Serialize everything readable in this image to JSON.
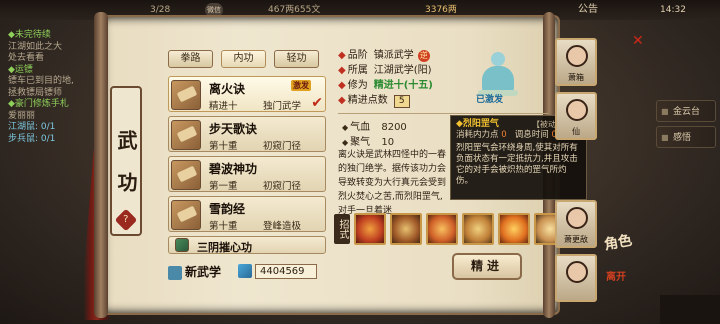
{
  "topbar": {
    "counter1": "3/28",
    "qq": "微信",
    "currency1": "467两655文",
    "currency2": "3376两",
    "notice": "公告",
    "time": "14:32"
  },
  "quest": {
    "lines": [
      {
        "text": "◆未完待续",
        "cls": "qt"
      },
      {
        "text": "江湖如此之大",
        "cls": "qx"
      },
      {
        "text": "处去看看",
        "cls": "qx"
      },
      {
        "text": "◆运镖",
        "cls": "qt"
      },
      {
        "text": "镖车已到目的地,",
        "cls": "qx"
      },
      {
        "text": "拯救镖局镖师",
        "cls": "qx"
      },
      {
        "text": "◆豪门修炼手札",
        "cls": "qt"
      },
      {
        "text": "爱丽丽",
        "cls": "qx"
      },
      {
        "text": "江湖鼠: 0/1",
        "cls": "qy"
      },
      {
        "text": "步兵鼠: 0/1",
        "cls": "qy"
      }
    ]
  },
  "title": "武功",
  "tabs": [
    "拳路",
    "内功",
    "轻功"
  ],
  "skills": [
    {
      "name": "离火诀",
      "level": "精进十",
      "path": "独门武学",
      "badge": "激发",
      "active": true
    },
    {
      "name": "步天歌诀",
      "level": "第十重",
      "path": "初窥门径",
      "badge": "",
      "active": false
    },
    {
      "name": "碧波神功",
      "level": "第一重",
      "path": "初窥门径",
      "badge": "",
      "active": false
    },
    {
      "name": "雪韵经",
      "level": "第十重",
      "path": "登峰造极",
      "badge": "",
      "active": false
    },
    {
      "name": "三阴摧心功",
      "level": "",
      "path": "",
      "badge": "",
      "active": false
    }
  ],
  "new_skill_label": "新武学",
  "skill_points": "4404569",
  "info": {
    "grade_k": "品阶",
    "grade_v": "镇派武学",
    "grade_seal": "逆",
    "belong_k": "所属",
    "belong_v": "江湖武学(阳)",
    "cult_k": "修为",
    "cult_v": "精进十(十五)",
    "pts_k": "精进点数",
    "pts_v": "5"
  },
  "monk_label": "已激发",
  "stats": {
    "hp_k": "气血",
    "hp_v": "8200",
    "qi_k": "聚气",
    "qi_v": "10"
  },
  "description": "离火诀是武林四怪中的一春的独门绝学。据传该功力会导致转变为大行真元会受到烈火焚心之苦,而烈阳罡气,对手一旦着迷",
  "moves_label": "招式",
  "practice_button": "精进",
  "tooltip": {
    "title": "◆烈阳罡气",
    "tag": "【被动招式】",
    "cost_k": "消耗内力点",
    "cost_v": "0",
    "cd_k": "调息时间",
    "cd_v": "0",
    "desc": "烈阳罡气会环绕身周,使其对所有负面状态有一定抵抗力,并且攻击它的对手会被炽热的罡气所灼伤。"
  },
  "right_chars": [
    {
      "label": "萧箱"
    },
    {
      "label": "仙"
    },
    {
      "label": "萧更敌"
    },
    {
      "label": ""
    }
  ],
  "side_menu": [
    "金云台",
    "感悟"
  ],
  "angle_text": "角色",
  "angle_sub": "离开"
}
